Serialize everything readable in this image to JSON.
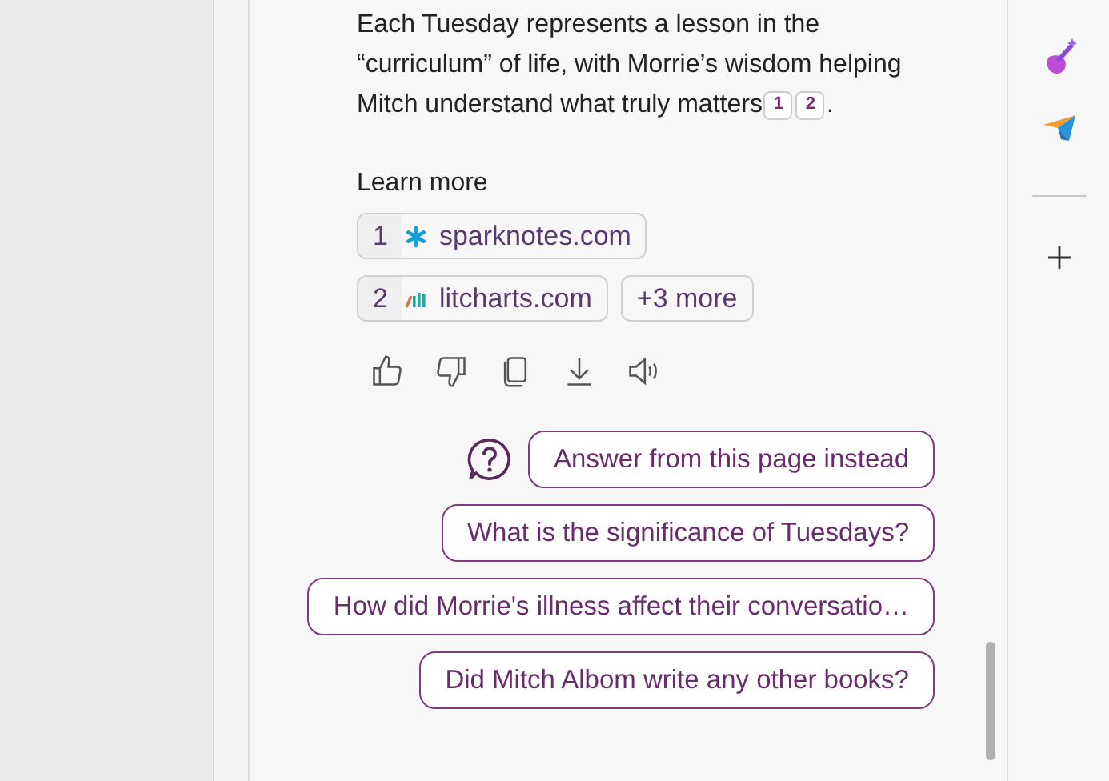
{
  "answer": {
    "text": "Each Tuesday represents a lesson in the “curriculum” of life, with Morrie’s wisdom helping Mitch understand what truly matters",
    "citations": [
      "1",
      "2"
    ],
    "end": "."
  },
  "learn_more": {
    "label": "Learn more",
    "sources": [
      {
        "number": "1",
        "site": "sparknotes.com",
        "kind": "asterisk"
      },
      {
        "number": "2",
        "site": "litcharts.com",
        "kind": "bars"
      }
    ],
    "more": "+3 more"
  },
  "suggestions": [
    "Answer from this page instead",
    "What is the significance of Tuesdays?",
    "How did Morrie's illness affect their conversatio…",
    "Did Mitch Albom write any other books?"
  ]
}
